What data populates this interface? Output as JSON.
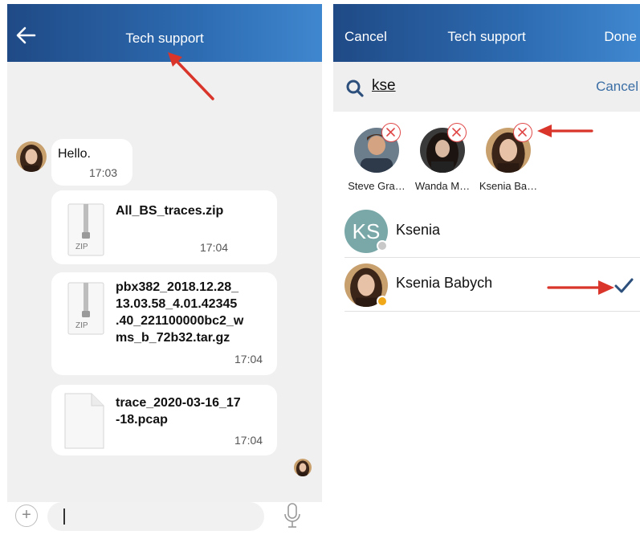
{
  "chat": {
    "title": "Tech support",
    "messages": [
      {
        "text": "Hello.",
        "time": "17:03"
      }
    ],
    "files": [
      {
        "name_lines": [
          "All_BS_traces.zip"
        ],
        "time": "17:04",
        "badge": "ZIP"
      },
      {
        "name_lines": [
          "pbx382_2018.12.28_",
          "13.03.58_4.01.42345",
          ".40_221100000bc2_w",
          "ms_b_72b32.tar.gz"
        ],
        "time": "17:04",
        "badge": "ZIP"
      },
      {
        "name_lines": [
          "trace_2020-03-16_17",
          "-18.pcap"
        ],
        "time": "17:04"
      }
    ],
    "input": {
      "plus": "+",
      "value": ""
    }
  },
  "members": {
    "header": {
      "cancel": "Cancel",
      "title": "Tech support",
      "done": "Done"
    },
    "search": {
      "query": "kse",
      "cancel": "Cancel"
    },
    "selected": [
      {
        "name": "Steve Gra…"
      },
      {
        "name": "Wanda M…"
      },
      {
        "name": "Ksenia Ba…"
      }
    ],
    "results": [
      {
        "initials": "KS",
        "name": "Ksenia",
        "status": "offline"
      },
      {
        "name": "Ksenia Babych",
        "status": "away",
        "checked": true
      }
    ]
  },
  "colors": {
    "header_gradient_start": "#1f4a86",
    "header_gradient_end": "#3f87cf",
    "annotation_arrow": "#d9352a",
    "check": "#2c4f7c",
    "remove_x": "#e04848",
    "away": "#f0a818",
    "offline": "#c8c8c8"
  }
}
